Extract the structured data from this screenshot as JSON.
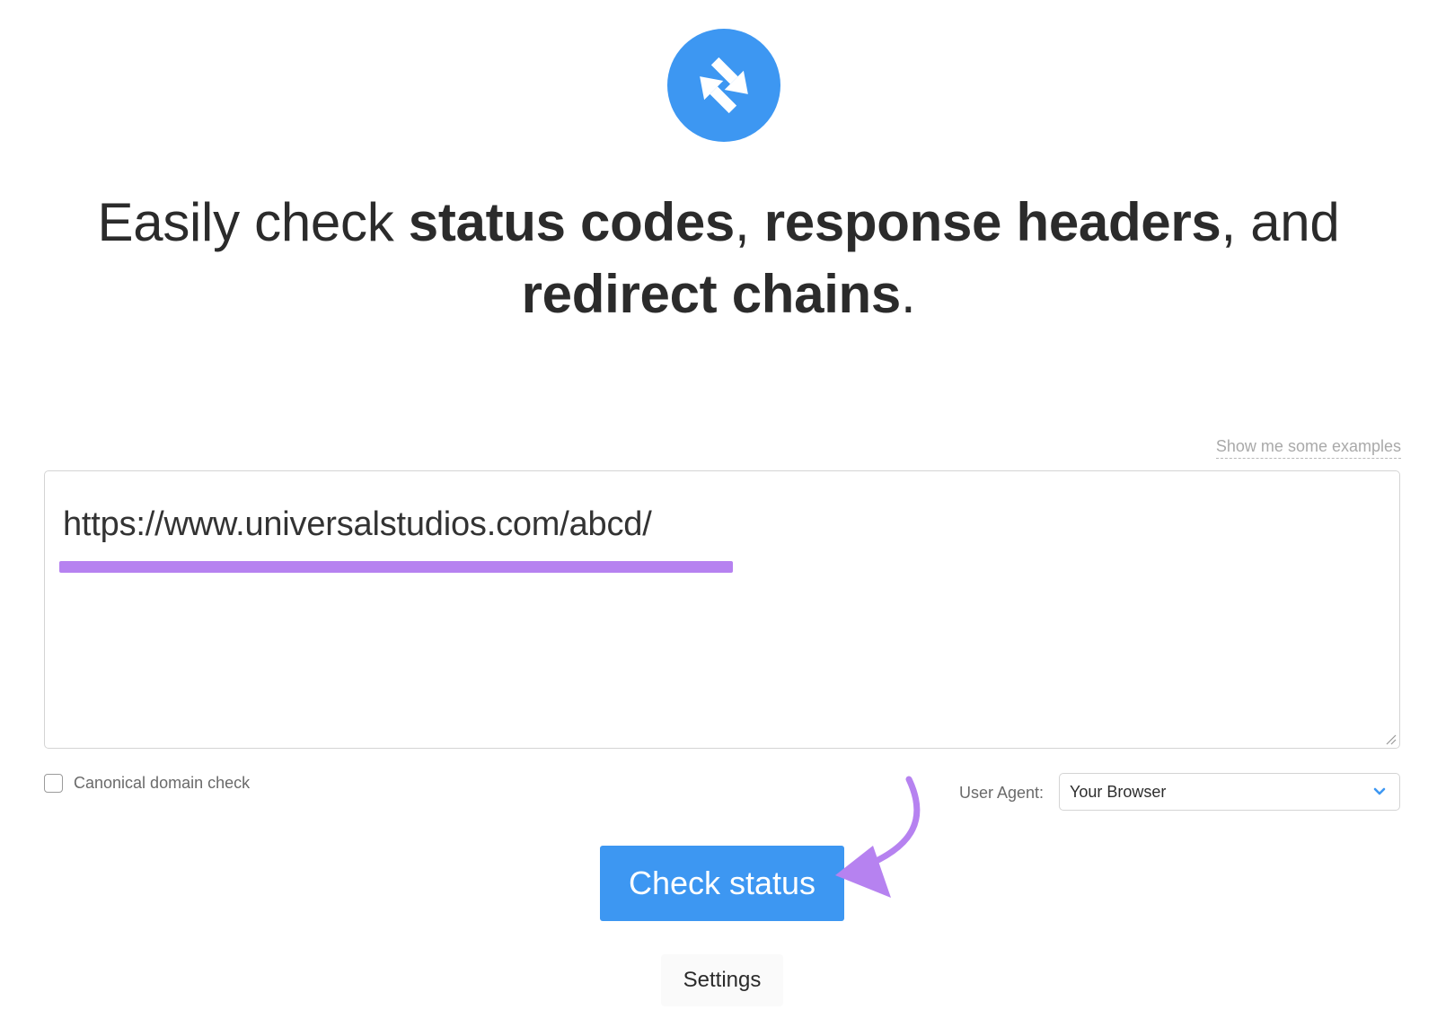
{
  "logo": {
    "icon": "redirect-arrows-icon",
    "color": "#3d97f2"
  },
  "headline": {
    "part1": "Easily check ",
    "bold1": "status codes",
    "part2": ", ",
    "bold2": "response headers",
    "part3": ", and ",
    "bold3": "redirect chains",
    "part4": "."
  },
  "examples_link": "Show me some examples",
  "url_input": {
    "value": "https://www.universalstudios.com/abcd/",
    "highlight_color": "#b682f0"
  },
  "options": {
    "canonical_label": "Canonical domain check",
    "canonical_checked": false,
    "user_agent_label": "User Agent:",
    "user_agent_value": "Your Browser"
  },
  "buttons": {
    "check_status": "Check status",
    "settings": "Settings"
  },
  "colors": {
    "accent": "#3d97f2",
    "annotation": "#b682f0"
  }
}
